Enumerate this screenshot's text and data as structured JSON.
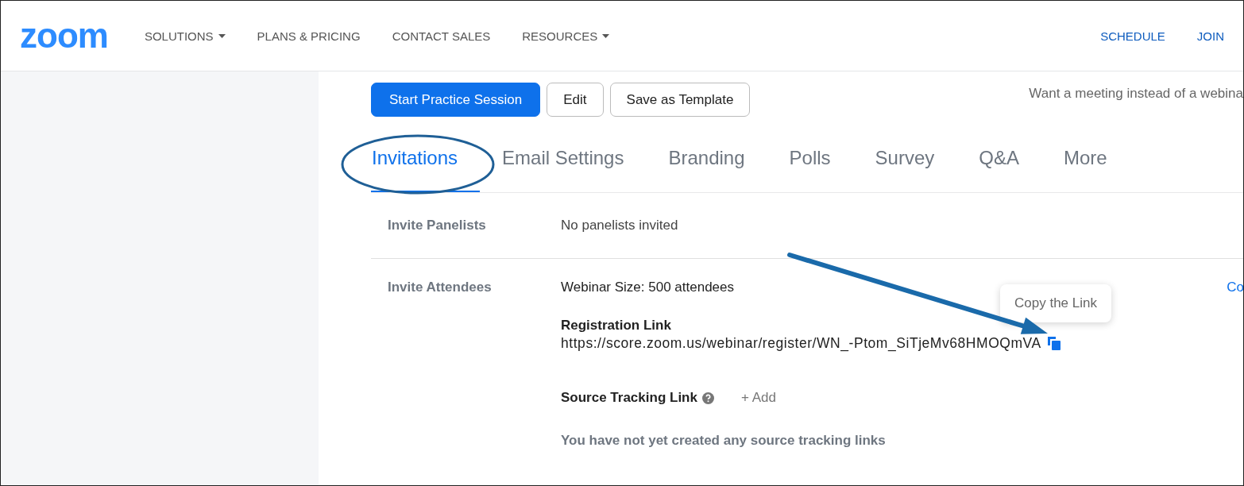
{
  "header": {
    "logo": "zoom",
    "nav": [
      {
        "label": "SOLUTIONS",
        "dropdown": true
      },
      {
        "label": "PLANS & PRICING",
        "dropdown": false
      },
      {
        "label": "CONTACT SALES",
        "dropdown": false
      },
      {
        "label": "RESOURCES",
        "dropdown": true
      }
    ],
    "actions": [
      "SCHEDULE",
      "JOIN"
    ]
  },
  "toolbar": {
    "buttons": [
      {
        "label": "Start Practice Session",
        "kind": "primary"
      },
      {
        "label": "Edit",
        "kind": "secondary"
      },
      {
        "label": "Save as Template",
        "kind": "secondary"
      }
    ],
    "note": "Want a meeting instead of a webina"
  },
  "tabs": [
    {
      "label": "Invitations",
      "selected": true
    },
    {
      "label": "Email Settings",
      "selected": false
    },
    {
      "label": "Branding",
      "selected": false
    },
    {
      "label": "Polls",
      "selected": false
    },
    {
      "label": "Survey",
      "selected": false
    },
    {
      "label": "Q&A",
      "selected": false
    },
    {
      "label": "More",
      "selected": false
    }
  ],
  "panelists": {
    "label": "Invite Panelists",
    "value": "No panelists invited"
  },
  "attendees": {
    "label": "Invite Attendees",
    "size": "Webinar Size: 500 attendees",
    "side_link": "Co",
    "registration_label": "Registration Link",
    "registration_url": "https://score.zoom.us/webinar/register/WN_-Ptom_SiTjeMv68HMOQmVA",
    "tooltip": "Copy the Link",
    "tracking_label": "Source Tracking Link",
    "add": "+ Add",
    "empty": "You have not yet created any source tracking links"
  }
}
